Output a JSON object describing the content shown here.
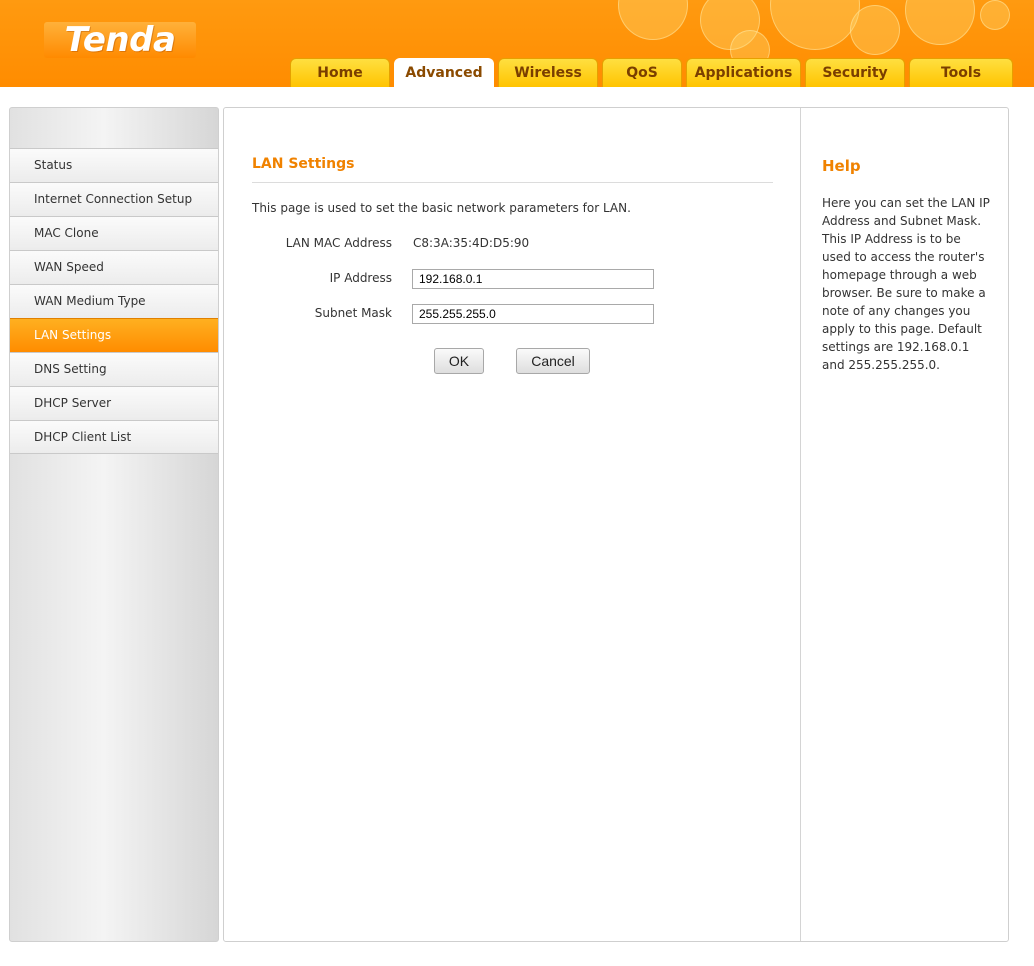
{
  "brand": {
    "logo_text": "Tenda",
    "accent_color": "#ff8c00",
    "tab_color": "#ffc400"
  },
  "nav": {
    "tabs": [
      {
        "label": "Home",
        "active": false
      },
      {
        "label": "Advanced",
        "active": true
      },
      {
        "label": "Wireless",
        "active": false
      },
      {
        "label": "QoS",
        "active": false
      },
      {
        "label": "Applications",
        "active": false
      },
      {
        "label": "Security",
        "active": false
      },
      {
        "label": "Tools",
        "active": false
      }
    ]
  },
  "sidebar": {
    "items": [
      {
        "label": "Status",
        "active": false
      },
      {
        "label": "Internet Connection Setup",
        "active": false
      },
      {
        "label": "MAC Clone",
        "active": false
      },
      {
        "label": "WAN Speed",
        "active": false
      },
      {
        "label": "WAN Medium Type",
        "active": false
      },
      {
        "label": "LAN Settings",
        "active": true
      },
      {
        "label": "DNS Setting",
        "active": false
      },
      {
        "label": "DHCP Server",
        "active": false
      },
      {
        "label": "DHCP Client List",
        "active": false
      }
    ]
  },
  "main": {
    "title": "LAN Settings",
    "description": "This page is used to set the basic network parameters for LAN.",
    "form": {
      "mac_label": "LAN MAC Address",
      "mac_value": "C8:3A:35:4D:D5:90",
      "ip_label": "IP Address",
      "ip_value": "192.168.0.1",
      "mask_label": "Subnet Mask",
      "mask_value": "255.255.255.0"
    },
    "buttons": {
      "ok": "OK",
      "cancel": "Cancel"
    }
  },
  "help": {
    "title": "Help",
    "text": "Here you can set the LAN IP Address and Subnet Mask. This IP Address is to be used to access the router's homepage through a web browser. Be sure to make a note of any changes you apply to this page. Default settings are 192.168.0.1 and 255.255.255.0."
  }
}
